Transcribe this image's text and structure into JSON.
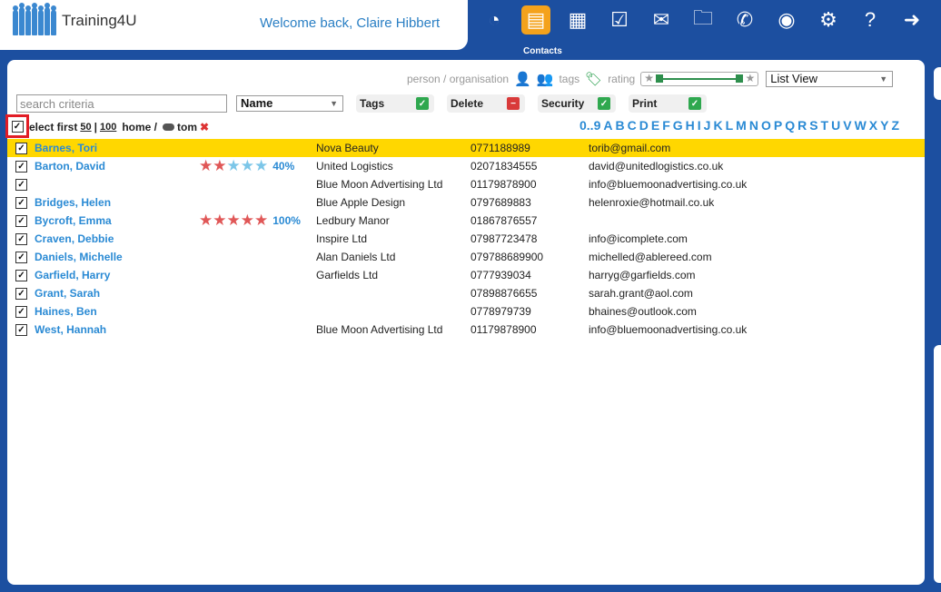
{
  "app": {
    "title": "Training4U",
    "welcome": "Welcome back, Claire Hibbert"
  },
  "nav": {
    "items": [
      {
        "name": "dashboard-icon",
        "glyph": "◔"
      },
      {
        "name": "contacts-icon",
        "glyph": "▤",
        "active": true
      },
      {
        "name": "calendar-icon",
        "glyph": "▦"
      },
      {
        "name": "tasks-icon",
        "glyph": "☑"
      },
      {
        "name": "mail-icon",
        "glyph": "✉"
      },
      {
        "name": "folder-icon",
        "glyph": "🗀"
      },
      {
        "name": "phone-icon",
        "glyph": "✆"
      },
      {
        "name": "user-icon",
        "glyph": "◉"
      },
      {
        "name": "settings-icon",
        "glyph": "⚙"
      },
      {
        "name": "help-icon",
        "glyph": "?"
      },
      {
        "name": "logout-icon",
        "glyph": "➜"
      }
    ],
    "active_caption": "Contacts"
  },
  "filters": {
    "person_org": "person / organisation",
    "tags": "tags",
    "rating": "rating",
    "view": "List View"
  },
  "toolbar": {
    "search_placeholder": "search criteria",
    "sort": "Name",
    "tags": "Tags",
    "delete": "Delete",
    "security": "Security",
    "print": "Print"
  },
  "selection": {
    "prefix": "elect first",
    "n50": "50",
    "sep": "|",
    "n100": "100",
    "crumb_home": "home /",
    "crumb_tag": "tom"
  },
  "alphabet": [
    "0..9",
    "A",
    "B",
    "C",
    "D",
    "E",
    "F",
    "G",
    "H",
    "I",
    "J",
    "K",
    "L",
    "M",
    "N",
    "O",
    "P",
    "Q",
    "R",
    "S",
    "T",
    "U",
    "V",
    "W",
    "X",
    "Y",
    "Z"
  ],
  "contacts": [
    {
      "name": "Barnes, Tori",
      "org": "Nova Beauty",
      "phone": "0771188989",
      "email": "torib@gmail.com",
      "highlight": true
    },
    {
      "name": "Barton, David",
      "org": "United Logistics",
      "phone": "02071834555",
      "email": "david@unitedlogistics.co.uk",
      "rating": 0.4,
      "rating_label": "40%"
    },
    {
      "name": "",
      "org": "Blue Moon Advertising Ltd",
      "phone": "01179878900",
      "email": "info@bluemoonadvertising.co.uk"
    },
    {
      "name": "Bridges, Helen",
      "org": "Blue Apple Design",
      "phone": "0797689883",
      "email": "helenroxie@hotmail.co.uk"
    },
    {
      "name": "Bycroft, Emma",
      "org": "Ledbury Manor",
      "phone": "01867876557",
      "email": "",
      "rating": 1.0,
      "rating_label": "100%"
    },
    {
      "name": "Craven, Debbie",
      "org": "Inspire Ltd",
      "phone": "07987723478",
      "email": "info@icomplete.com"
    },
    {
      "name": "Daniels, Michelle",
      "org": "Alan Daniels Ltd",
      "phone": "079788689900",
      "email": "michelled@ablereed.com"
    },
    {
      "name": "Garfield, Harry",
      "org": "Garfields Ltd",
      "phone": "0777939034",
      "email": "harryg@garfields.com"
    },
    {
      "name": "Grant, Sarah",
      "org": "",
      "phone": "07898876655",
      "email": "sarah.grant@aol.com"
    },
    {
      "name": "Haines, Ben",
      "org": "",
      "phone": "0778979739",
      "email": "bhaines@outlook.com"
    },
    {
      "name": "West, Hannah",
      "org": "Blue Moon Advertising Ltd",
      "phone": "01179878900",
      "email": "info@bluemoonadvertising.co.uk"
    }
  ],
  "colors": {
    "accent": "#2a8ad4",
    "nav_bg": "#1c4fa0",
    "highlight": "#ffd700",
    "active_nav": "#f4a21c",
    "select_outline": "#e21d26"
  }
}
